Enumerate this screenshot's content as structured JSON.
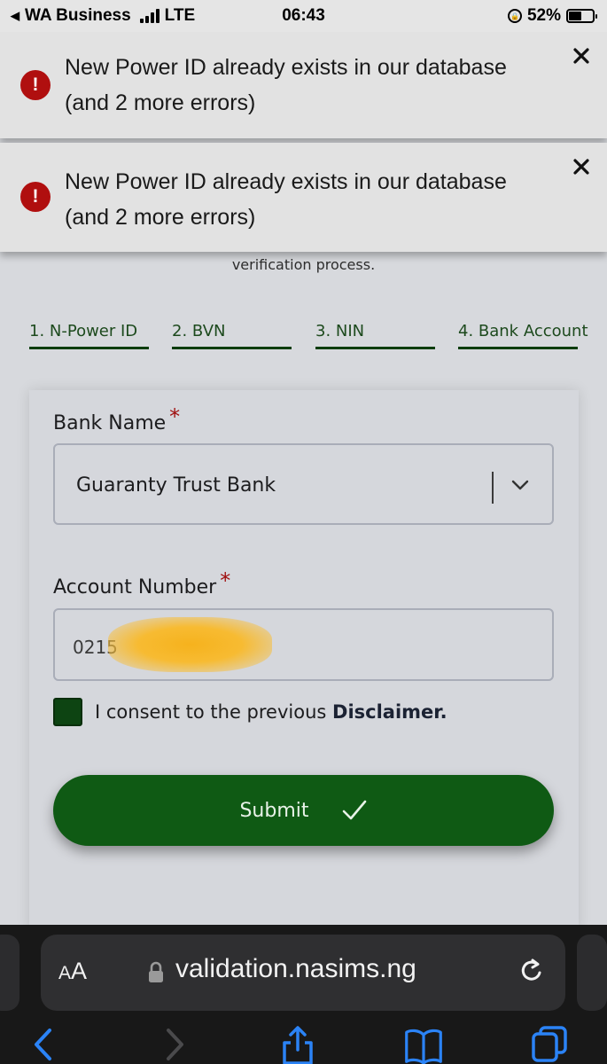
{
  "status_bar": {
    "carrier": "WA Business",
    "network": "LTE",
    "time": "06:43",
    "battery": "52%",
    "battery_level": 0.52
  },
  "toasts": [
    {
      "line1": "New Power ID already exists in our database",
      "line2": "(and 2 more errors)",
      "icon": "error-icon"
    },
    {
      "line1": "New Power ID already exists in our database",
      "line2": "(and 2 more errors)",
      "icon": "error-icon"
    }
  ],
  "page": {
    "subtitle": "verification process.",
    "steps": [
      {
        "label": "1. N-Power ID"
      },
      {
        "label": "2. BVN"
      },
      {
        "label": "3. NIN"
      },
      {
        "label": "4. Bank Account"
      }
    ]
  },
  "form": {
    "bank_name_label": "Bank Name",
    "required_mark": "*",
    "bank_name_value": "Guaranty Trust Bank",
    "account_number_label": "Account Number",
    "account_number_value": "0215",
    "consent_text": "I consent to the previous",
    "consent_link": "Disclaimer.",
    "consent_checked": true,
    "submit_label": "Submit"
  },
  "browser": {
    "text_size_label": "AA",
    "url": "validation.nasims.ng"
  },
  "colors": {
    "accent_green": "#0f5a14",
    "error_red": "#b00f0f",
    "step_underline": "#0d3d0d"
  }
}
